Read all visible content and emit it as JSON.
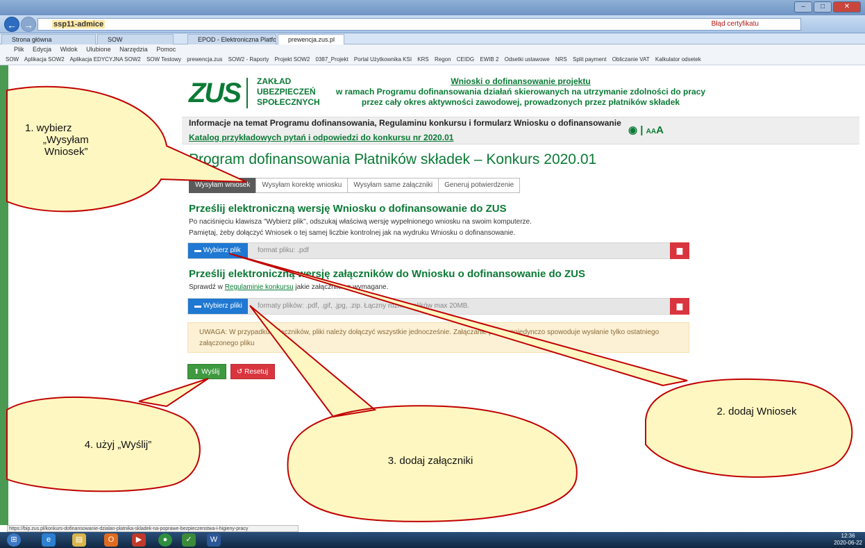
{
  "browser": {
    "url_host": "ssp11-admice",
    "cert_text": "Błąd certyfikatu",
    "tabs": [
      {
        "label": "Strona główna"
      },
      {
        "label": "SOW"
      },
      {
        "label": "EPOD - Elektroniczna Platform..."
      },
      {
        "label": "prewencja.zus.pl"
      }
    ],
    "menu": [
      "Plik",
      "Edycja",
      "Widok",
      "Ulubione",
      "Narzędzia",
      "Pomoc"
    ],
    "favorites": [
      "SOW",
      "Aplikacja SOW2",
      "Aplikacja EDYCYJNA SOW2",
      "SOW Testowy",
      "prewencja.zus",
      "SOW2 - Raporty",
      "Projekt SOW2",
      "0387_Projekt",
      "Portal Użytkownika KSI",
      "KRS",
      "Regon",
      "CEIDG",
      "EWIB 2",
      "Odsetki ustawowe",
      "NRS",
      "Split payment",
      "Obliczanie VAT",
      "Kalkulator odsetek"
    ],
    "status_url": "https://bip.zus.pl/konkurs-dofinansowanie-dzialan-platnika-skladek-na-poprawe-bezpieczenstwa-i-higieny-pracy"
  },
  "header": {
    "logo": "ZUS",
    "org_line1": "ZAKŁAD",
    "org_line2": "UBEZPIECZEŃ",
    "org_line3": "SPOŁECZNYCH",
    "title_link": "Wnioski o dofinansowanie projektu",
    "title_line2": "w ramach Programu dofinansowania działań skierowanych na utrzymanie zdolności do pracy",
    "title_line3": "przez cały okres aktywności zawodowej, prowadzonych przez płatników składek"
  },
  "info": {
    "line1": "Informacje na temat Programu dofinansowania, Regulaminu konkursu i formularz Wniosku o dofinansowanie",
    "line2": "Katalog przykładowych pytań i odpowiedzi do konkursu nr 2020.01",
    "access_small": "A",
    "access_big": "A"
  },
  "page": {
    "title": "Program dofinansowania Płatników składek – Konkurs 2020.01",
    "tabs": [
      "Wysyłam wniosek",
      "Wysyłam korektę wniosku",
      "Wysyłam same załączniki",
      "Generuj potwierdzenie"
    ],
    "section1": {
      "heading": "Prześlij elektroniczną wersję Wniosku o dofinansowanie do ZUS",
      "text1": "Po naciśnięciu klawisza \"Wybierz plik\", odszukaj właściwą wersję wypełnionego wniosku na swoim komputerze.",
      "text2": "Pamiętaj, żeby dołączyć Wniosek o tej samej liczbie kontrolnej jak na wydruku Wniosku o dofinansowanie.",
      "button": "Wybierz plik",
      "placeholder": "format pliku: .pdf"
    },
    "section2": {
      "heading": "Prześlij elektroniczną wersję załączników do Wniosku o dofinansowanie do ZUS",
      "text_pre": "Sprawdź w",
      "text_link": "Regulaminie konkursu",
      "text_post": "jakie załączniki są wymagane.",
      "button": "Wybierz pliki",
      "placeholder": "formaty plików: .pdf, .gif, .jpg, .zip. Łączny rozmiar plików max 20MB."
    },
    "warning": "UWAGA: W przypadku załączników, pliki należy dołączyć wszystkie jednocześnie. Załączanie plików pojedynczo spowoduje wysłanie tylko ostatniego załączonego pliku",
    "send": "Wyślij",
    "reset": "Resetuj"
  },
  "callouts": {
    "c1_line1": "1.   wybierz",
    "c1_line2": "„Wysyłam",
    "c1_line3": "Wniosek”",
    "c2": "2. dodaj Wniosek",
    "c3": "3. dodaj załączniki",
    "c4": "4. użyj „Wyślij”"
  },
  "taskbar": {
    "time": "12:36",
    "date": "2020-06-22"
  },
  "colors": {
    "zus_green": "#0a7a35",
    "callout_fill": "#fff7c2",
    "callout_border": "#c00000",
    "button_blue": "#1f78d1",
    "button_red": "#d9353f"
  }
}
